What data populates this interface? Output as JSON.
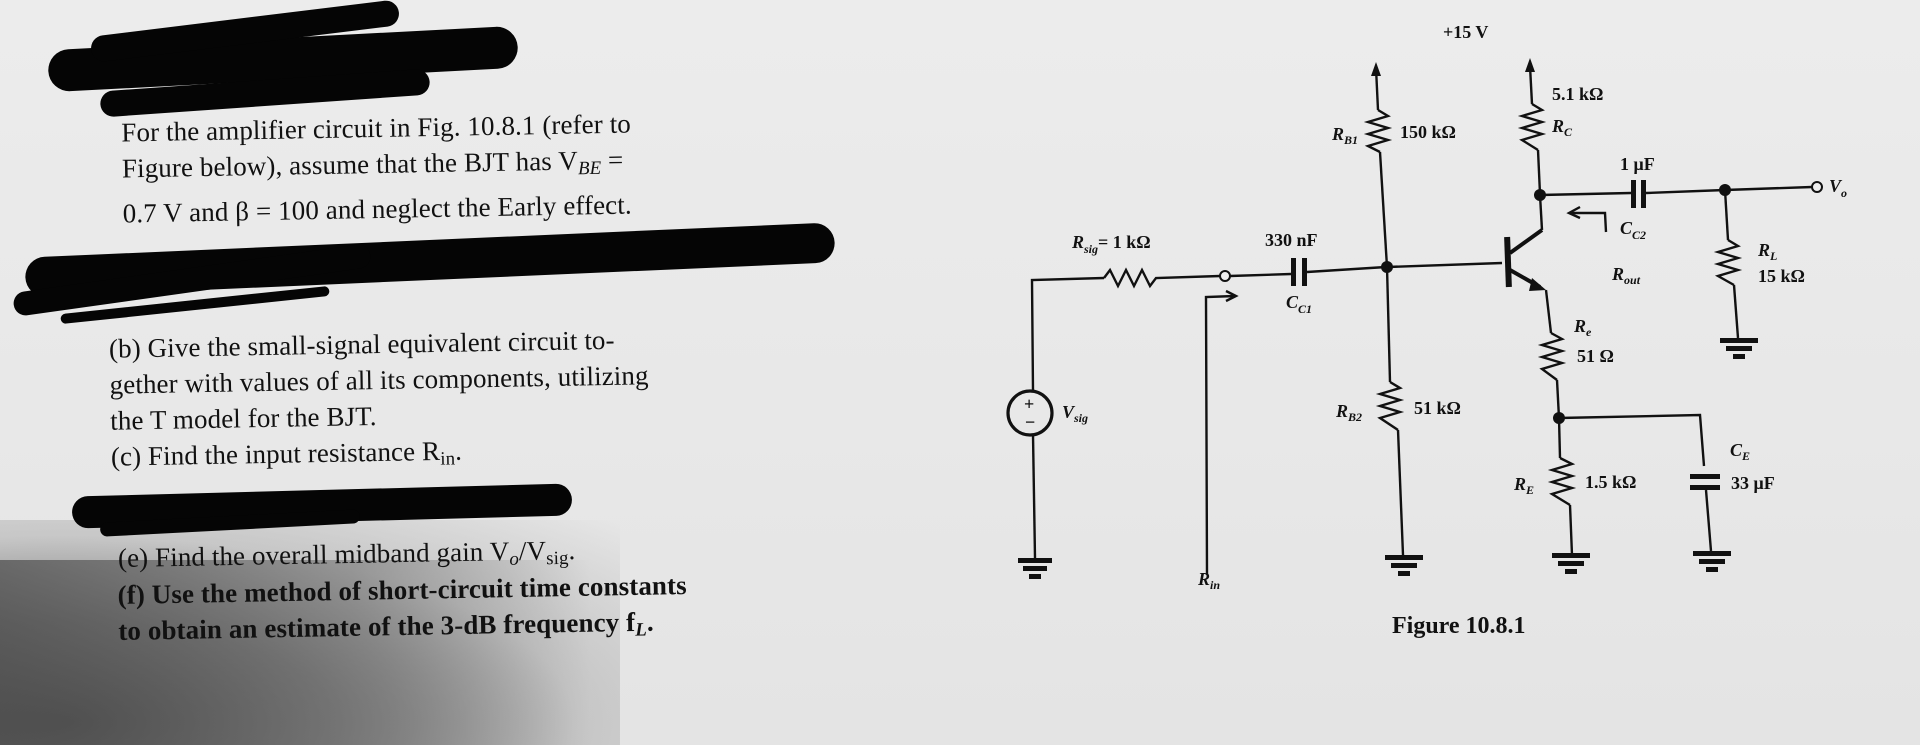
{
  "problem": {
    "intro_lines": [
      "For the amplifier circuit in Fig. 10.8.1 (refer to",
      "Figure below), assume that the BJT has V",
      "0.7 V and β = 100 and neglect the Early effect."
    ],
    "intro_vbe_sub": "BE",
    "intro_vbe_eq": " =",
    "part_b": [
      "(b) Give the small-signal equivalent circuit to-",
      "gether with values of all its components, utilizing",
      "the T model for the BJT."
    ],
    "part_c": "(c) Find the input resistance R",
    "part_c_sub": "in",
    "part_e": "(e) Find the overall midband gain V",
    "part_e_mid": "o",
    "part_e_slash": "/V",
    "part_e_sub": "sig",
    "part_f": [
      "(f) Use the method of short-circuit time constants",
      "to obtain an estimate of the 3-dB frequency f"
    ],
    "part_f_sub": "L",
    "redactions": [
      "scribble-top",
      "scribble-part-a",
      "scribble-part-d"
    ]
  },
  "figure": {
    "caption": "Figure 10.8.1",
    "supply": "+15 V",
    "components": {
      "rsig": {
        "label": "R",
        "sub": "sig",
        "value": "= 1 kΩ"
      },
      "cc1": {
        "label": "C",
        "sub": "C1",
        "value": "330 nF"
      },
      "rb1": {
        "label": "R",
        "sub": "B1",
        "value": "150 kΩ"
      },
      "rb2": {
        "label": "R",
        "sub": "B2",
        "value": "51 kΩ"
      },
      "rc": {
        "label": "R",
        "sub": "C",
        "value": "5.1 kΩ"
      },
      "cc2": {
        "label": "C",
        "sub": "C2",
        "value": "1 μF"
      },
      "re_small": {
        "label": "R",
        "sub": "e",
        "value": "51 Ω"
      },
      "re": {
        "label": "R",
        "sub": "E",
        "value": "1.5 kΩ"
      },
      "ce": {
        "label": "C",
        "sub": "E",
        "value": "33 μF"
      },
      "rl": {
        "label": "R",
        "sub": "L",
        "value": "15 kΩ"
      }
    },
    "source": {
      "label": "V",
      "sub": "sig",
      "plus": "+",
      "minus": "−"
    },
    "output": {
      "label": "V",
      "sub": "o"
    },
    "rin": {
      "label": "R",
      "sub": "in"
    },
    "rout": {
      "label": "R",
      "sub": "out"
    }
  }
}
